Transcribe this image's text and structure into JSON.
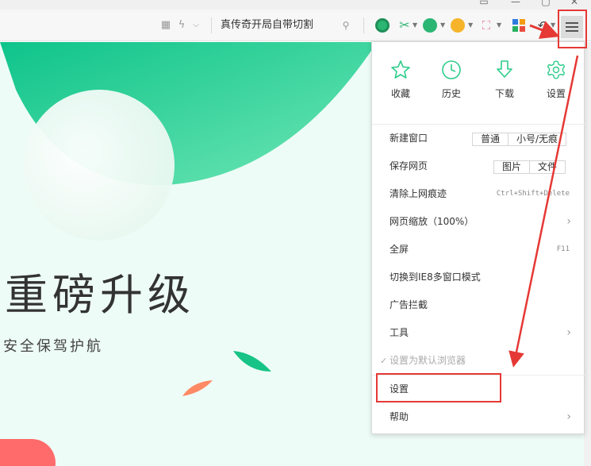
{
  "toolbar": {
    "search_text": "真传奇开局自带切割",
    "menu_button": "menu"
  },
  "page": {
    "headline": "重磅升级",
    "subline": "安全保驾护航"
  },
  "menu": {
    "quick": [
      {
        "label": "收藏",
        "icon": "star-icon"
      },
      {
        "label": "历史",
        "icon": "clock-icon"
      },
      {
        "label": "下载",
        "icon": "download-icon"
      },
      {
        "label": "设置",
        "icon": "gear-icon"
      }
    ],
    "new_window": {
      "label": "新建窗口",
      "options": [
        "普通",
        "小号/无痕"
      ]
    },
    "save_page": {
      "label": "保存网页",
      "options": [
        "图片",
        "文件"
      ]
    },
    "clear_traces": {
      "label": "清除上网痕迹",
      "shortcut": "Ctrl+Shift+Delete"
    },
    "zoom": {
      "label": "网页缩放（100%）"
    },
    "fullscreen": {
      "label": "全屏",
      "shortcut": "F11"
    },
    "ie_mode": {
      "label": "切换到IE8多窗口模式"
    },
    "ad_block": {
      "label": "广告拦截"
    },
    "tools": {
      "label": "工具"
    },
    "default_browser": {
      "label": "设置为默认浏览器"
    },
    "settings": {
      "label": "设置"
    },
    "help": {
      "label": "帮助"
    }
  },
  "colors": {
    "accent": "#2ecc8b",
    "annotation": "#e53935",
    "page_bg": "#eefcf7"
  }
}
